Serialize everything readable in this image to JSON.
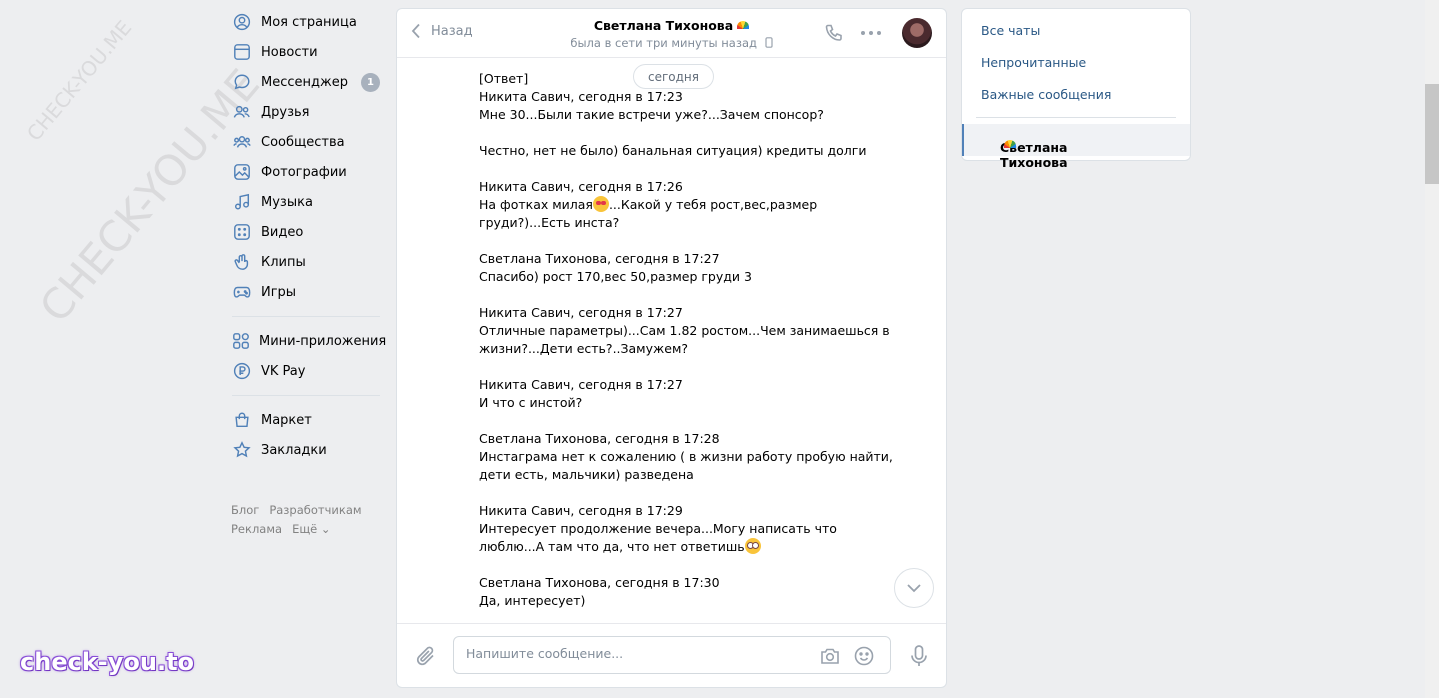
{
  "sidebar": {
    "items": [
      {
        "label": "Моя страница",
        "icon": "user-circle-icon"
      },
      {
        "label": "Новости",
        "icon": "news-icon"
      },
      {
        "label": "Мессенджер",
        "icon": "message-icon",
        "badge": "1"
      },
      {
        "label": "Друзья",
        "icon": "friends-icon"
      },
      {
        "label": "Сообщества",
        "icon": "communities-icon"
      },
      {
        "label": "Фотографии",
        "icon": "photo-icon"
      },
      {
        "label": "Музыка",
        "icon": "music-icon"
      },
      {
        "label": "Видео",
        "icon": "video-icon"
      },
      {
        "label": "Клипы",
        "icon": "clips-icon"
      },
      {
        "label": "Игры",
        "icon": "gamepad-icon"
      }
    ],
    "items2": [
      {
        "label": "Мини-приложения",
        "icon": "apps-icon"
      },
      {
        "label": "VK Pay",
        "icon": "vkpay-icon"
      }
    ],
    "items3": [
      {
        "label": "Маркет",
        "icon": "market-icon"
      },
      {
        "label": "Закладки",
        "icon": "bookmark-icon"
      }
    ],
    "footer": {
      "blog": "Блог",
      "dev": "Разработчикам",
      "ads": "Реклама",
      "more": "Ещё ⌄"
    }
  },
  "chat": {
    "back_label": "Назад",
    "peer_name": "Светлана Тихонова",
    "peer_status": "была в сети три минуты назад",
    "date_pill": "сегодня",
    "lines": [
      "[Ответ]",
      "Никита Савич, сегодня в 17:23",
      "Мне 30...Были такие встречи уже?...Зачем спонсор?",
      "",
      "Честно, нет не было) банальная ситуация) кредиты долги",
      "",
      "Никита Савич, сегодня в 17:26",
      "На фотках милая",
      "груди?)...Есть инста?",
      "",
      "Светлана Тихонова, сегодня в 17:27",
      "Спасибо) рост 170,вес 50,размер груди 3",
      "",
      "Никита Савич, сегодня в 17:27",
      "Отличные параметры)...Сам 1.82 ростом...Чем занимаешься в",
      "жизни?...Дети есть?..Замужем?",
      "",
      "Никита Савич, сегодня в 17:27",
      "И что с инстой?",
      "",
      "Светлана Тихонова, сегодня в 17:28",
      "Инстаграма нет к сожалению ( в жизни работу пробую найти,",
      "дети есть, мальчики) разведена",
      "",
      "Никита Савич, сегодня в 17:29",
      "Интересует продолжение вечера...Могу написать что",
      "люблю...А там что да, что нет ответишь",
      "",
      "Светлана Тихонова, сегодня в 17:30",
      "Да, интересует)"
    ],
    "line7_tail": "...Какой у тебя рост,вес,размер",
    "input_placeholder": "Напишите сообщение..."
  },
  "right_panel": {
    "all_chats": "Все чаты",
    "unread": "Непрочитанные",
    "important": "Важные сообщения",
    "active_chat": "Светлана Тихонова"
  },
  "watermarks": {
    "small": "CHECK-YOU.ME",
    "large": "CHECK-YOU.ME",
    "logo": "check-you.to"
  },
  "colors": {
    "accent": "#2a5885",
    "background": "#edeef0",
    "badge": "#a8b1bd"
  }
}
